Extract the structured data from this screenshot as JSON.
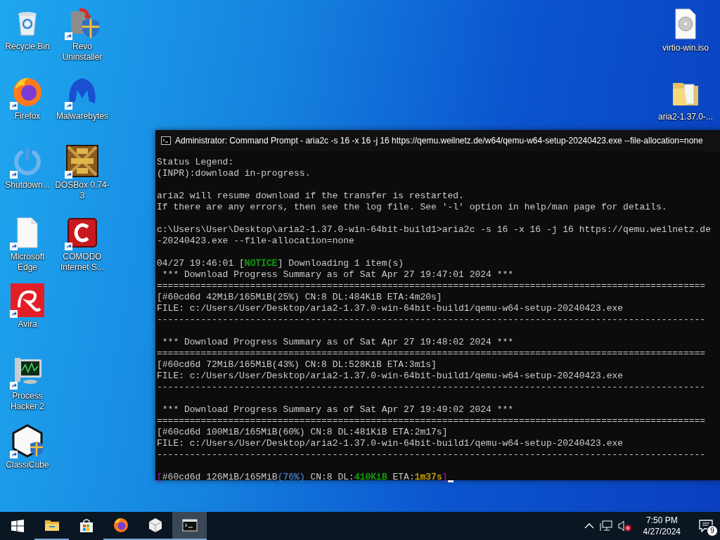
{
  "desktop_icons": [
    {
      "label": "Recycle Bin",
      "kind": "recycle",
      "shortcut": false
    },
    {
      "label": "Revo Uninstaller",
      "kind": "uninstaller",
      "shortcut": true
    },
    {
      "label": "Firefox",
      "kind": "firefox",
      "shortcut": true
    },
    {
      "label": "Malwarebytes",
      "kind": "malwarebytes",
      "shortcut": true
    },
    {
      "label": "Shutdown...",
      "kind": "shutdown",
      "shortcut": true
    },
    {
      "label": "DOSBox 0.74-3",
      "kind": "dosbox",
      "shortcut": true
    },
    {
      "label": "Microsoft Edge",
      "kind": "document",
      "shortcut": true
    },
    {
      "label": "COMODO Internet S...",
      "kind": "comodo",
      "shortcut": true
    },
    {
      "label": "Avira",
      "kind": "avira",
      "shortcut": true
    },
    {
      "label": "Process Hacker 2",
      "kind": "monitor",
      "shortcut": true
    },
    {
      "label": "ClassiCube",
      "kind": "cube",
      "shortcut": true
    },
    {
      "label": "virtio-win.iso",
      "kind": "disc",
      "shortcut": false
    },
    {
      "label": "aria2-1.37.0-...",
      "kind": "folder",
      "shortcut": false
    }
  ],
  "console": {
    "title": "Administrator: Command Prompt - aria2c  -s 16 -x 16 -j 16 https://qemu.weilnetz.de/w64/qemu-w64-setup-20240423.exe --file-allocation=none",
    "cursor": true,
    "lines": [
      {
        "kind": "text",
        "segments": [
          {
            "text": "Status Legend:"
          }
        ]
      },
      {
        "kind": "text",
        "segments": [
          {
            "text": "(INPR):download in-progress."
          }
        ]
      },
      {
        "kind": "blank"
      },
      {
        "kind": "text",
        "segments": [
          {
            "text": "aria2 will resume download if the transfer is restarted."
          }
        ]
      },
      {
        "kind": "text",
        "segments": [
          {
            "text": "If there are any errors, then see the log file. See '-l' option in help/man page for details."
          }
        ]
      },
      {
        "kind": "blank"
      },
      {
        "kind": "text",
        "segments": [
          {
            "text": "c:\\Users\\User\\Desktop\\aria2-1.37.0-win-64bit-build1>aria2c -s 16 -x 16 -j 16 https://qemu.weilnetz.de"
          }
        ]
      },
      {
        "kind": "text",
        "segments": [
          {
            "text": "-20240423.exe --file-allocation=none"
          }
        ]
      },
      {
        "kind": "blank"
      },
      {
        "kind": "text",
        "segments": [
          {
            "text": "04/27 19:46:01 ["
          },
          {
            "text": "NOTICE",
            "color": "#13a10e"
          },
          {
            "text": "] Downloading 1 item(s)"
          }
        ]
      },
      {
        "kind": "text",
        "segments": [
          {
            "text": " *** Download Progress Summary as of Sat Apr 27 19:47:01 2024 ***"
          }
        ]
      },
      {
        "kind": "text",
        "segments": [
          {
            "text": "===================================================================================================="
          }
        ]
      },
      {
        "kind": "text",
        "segments": [
          {
            "text": "[#60cd6d 42MiB/165MiB(25%) CN:8 DL:484KiB ETA:4m20s]"
          }
        ]
      },
      {
        "kind": "text",
        "segments": [
          {
            "text": "FILE: c:/Users/User/Desktop/aria2-1.37.0-win-64bit-build1/qemu-w64-setup-20240423.exe"
          }
        ]
      },
      {
        "kind": "text",
        "segments": [
          {
            "text": "----------------------------------------------------------------------------------------------------"
          }
        ]
      },
      {
        "kind": "blank"
      },
      {
        "kind": "text",
        "segments": [
          {
            "text": " *** Download Progress Summary as of Sat Apr 27 19:48:02 2024 ***"
          }
        ]
      },
      {
        "kind": "text",
        "segments": [
          {
            "text": "===================================================================================================="
          }
        ]
      },
      {
        "kind": "text",
        "segments": [
          {
            "text": "[#60cd6d 72MiB/165MiB(43%) CN:8 DL:528KiB ETA:3m1s]"
          }
        ]
      },
      {
        "kind": "text",
        "segments": [
          {
            "text": "FILE: c:/Users/User/Desktop/aria2-1.37.0-win-64bit-build1/qemu-w64-setup-20240423.exe"
          }
        ]
      },
      {
        "kind": "text",
        "segments": [
          {
            "text": "----------------------------------------------------------------------------------------------------"
          }
        ]
      },
      {
        "kind": "blank"
      },
      {
        "kind": "text",
        "segments": [
          {
            "text": " *** Download Progress Summary as of Sat Apr 27 19:49:02 2024 ***"
          }
        ]
      },
      {
        "kind": "text",
        "segments": [
          {
            "text": "===================================================================================================="
          }
        ]
      },
      {
        "kind": "text",
        "segments": [
          {
            "text": "[#60cd6d 100MiB/165MiB(60%) CN:8 DL:481KiB ETA:2m17s]"
          }
        ]
      },
      {
        "kind": "text",
        "segments": [
          {
            "text": "FILE: c:/Users/User/Desktop/aria2-1.37.0-win-64bit-build1/qemu-w64-setup-20240423.exe"
          }
        ]
      },
      {
        "kind": "text",
        "segments": [
          {
            "text": "----------------------------------------------------------------------------------------------------"
          }
        ]
      },
      {
        "kind": "blank"
      },
      {
        "kind": "text",
        "segments": [
          {
            "text": "[",
            "color": "#881798"
          },
          {
            "text": "#60cd6d 126MiB/165MiB"
          },
          {
            "text": "(76%)",
            "color": "#3a6fb0"
          },
          {
            "text": " CN:8 DL:"
          },
          {
            "text": "410KiB",
            "color": "#13a10e"
          },
          {
            "text": " ETA:"
          },
          {
            "text": "1m37s",
            "color": "#c19c00"
          },
          {
            "text": "]",
            "color": "#881798"
          }
        ]
      }
    ]
  },
  "taskbar": {
    "items": [
      {
        "kind": "explorer",
        "running": true,
        "selected": false
      },
      {
        "kind": "store",
        "running": false,
        "selected": false
      },
      {
        "kind": "firefox",
        "running": true,
        "selected": false
      },
      {
        "kind": "cube",
        "running": true,
        "selected": false
      },
      {
        "kind": "console",
        "running": true,
        "selected": true
      }
    ],
    "tray": {
      "volume_muted": true,
      "time": "7:50 PM",
      "date": "4/27/2024",
      "notifications": "9"
    }
  }
}
